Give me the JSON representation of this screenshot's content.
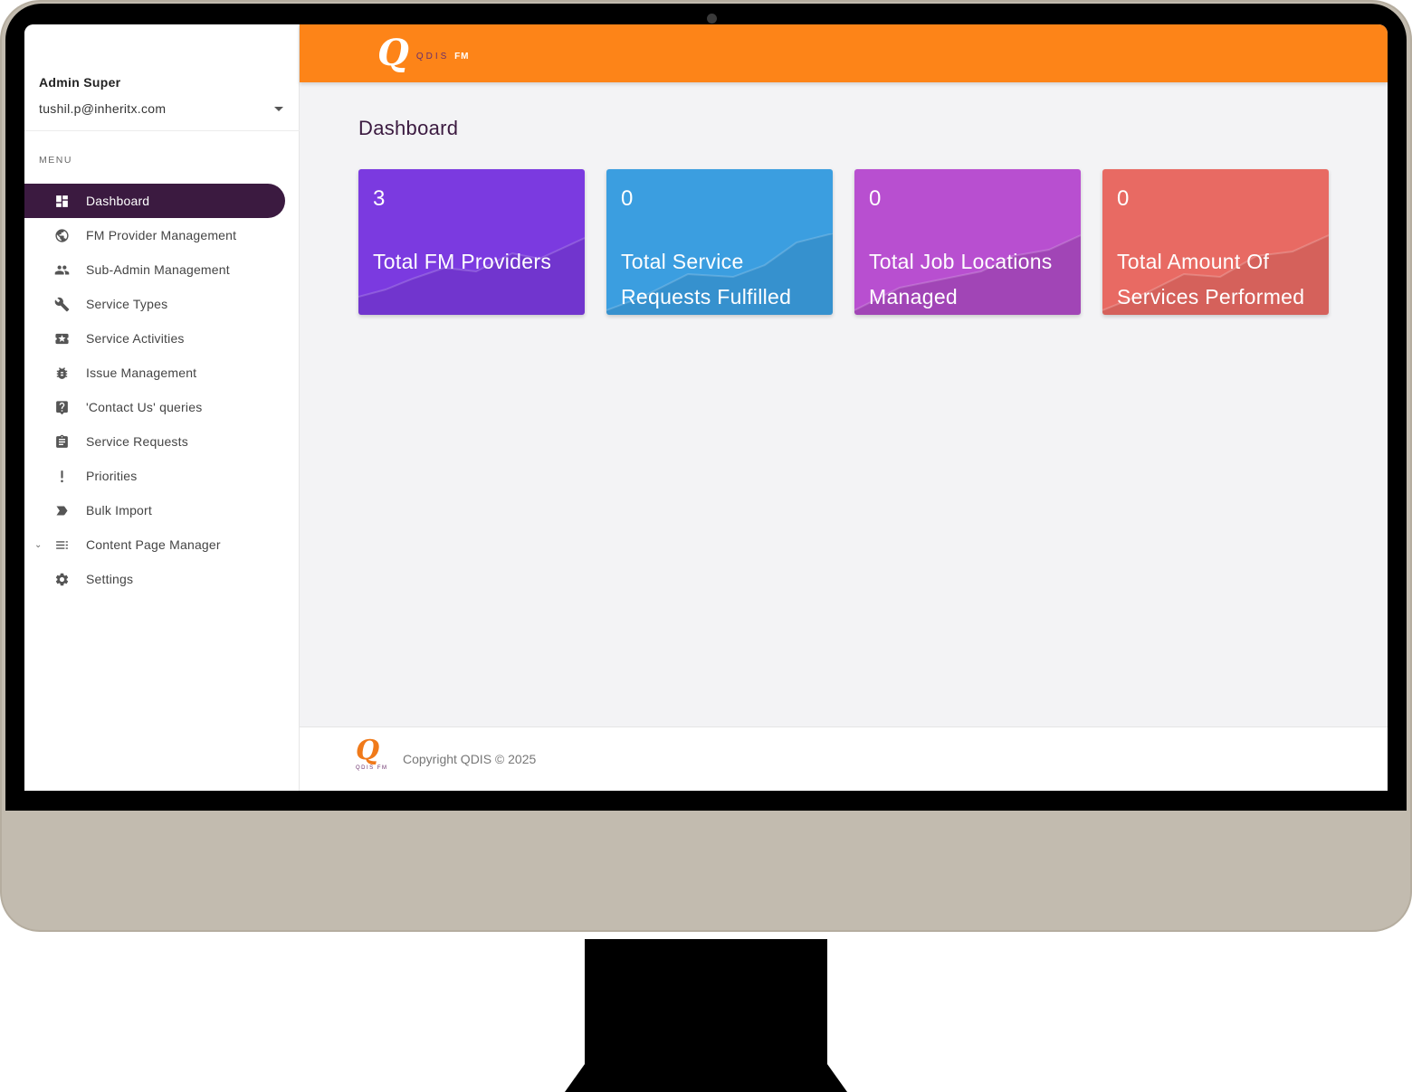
{
  "app": {
    "brand_letter": "Q",
    "brand_name": "QDIS",
    "brand_suffix": "FM"
  },
  "user": {
    "name": "Admin Super",
    "email": "tushil.p@inheritx.com"
  },
  "sidebar": {
    "menu_heading": "MENU",
    "items": [
      {
        "label": "Dashboard",
        "icon": "dashboard-icon",
        "active": true
      },
      {
        "label": "FM Provider Management",
        "icon": "globe-icon"
      },
      {
        "label": "Sub-Admin Management",
        "icon": "people-icon"
      },
      {
        "label": "Service Types",
        "icon": "wrench-icon"
      },
      {
        "label": "Service Activities",
        "icon": "ticket-icon"
      },
      {
        "label": "Issue Management",
        "icon": "bug-icon"
      },
      {
        "label": "'Contact Us' queries",
        "icon": "question-icon"
      },
      {
        "label": "Service Requests",
        "icon": "clipboard-icon"
      },
      {
        "label": "Priorities",
        "icon": "exclamation-icon"
      },
      {
        "label": "Bulk Import",
        "icon": "label-icon"
      },
      {
        "label": "Content Page Manager",
        "icon": "list-icon",
        "expandable": true
      },
      {
        "label": "Settings",
        "icon": "gear-icon"
      }
    ]
  },
  "main": {
    "title": "Dashboard",
    "cards": [
      {
        "value": "3",
        "label": "Total FM Providers",
        "color": "#7b3ae0"
      },
      {
        "value": "0",
        "label": "Total Service Requests Fulfilled",
        "color": "#3b9ee0"
      },
      {
        "value": "0",
        "label": "Total Job Locations Managed",
        "color": "#b84fd0"
      },
      {
        "value": "0",
        "label": "Total Amount Of Services Performed",
        "color": "#e86a63"
      }
    ]
  },
  "footer": {
    "logo_letter": "Q",
    "logo_text": "QDIS FM",
    "copyright": "Copyright QDIS © 2025"
  },
  "colors": {
    "topbar": "#fd8418",
    "sidebar_active": "#3b1a40"
  }
}
